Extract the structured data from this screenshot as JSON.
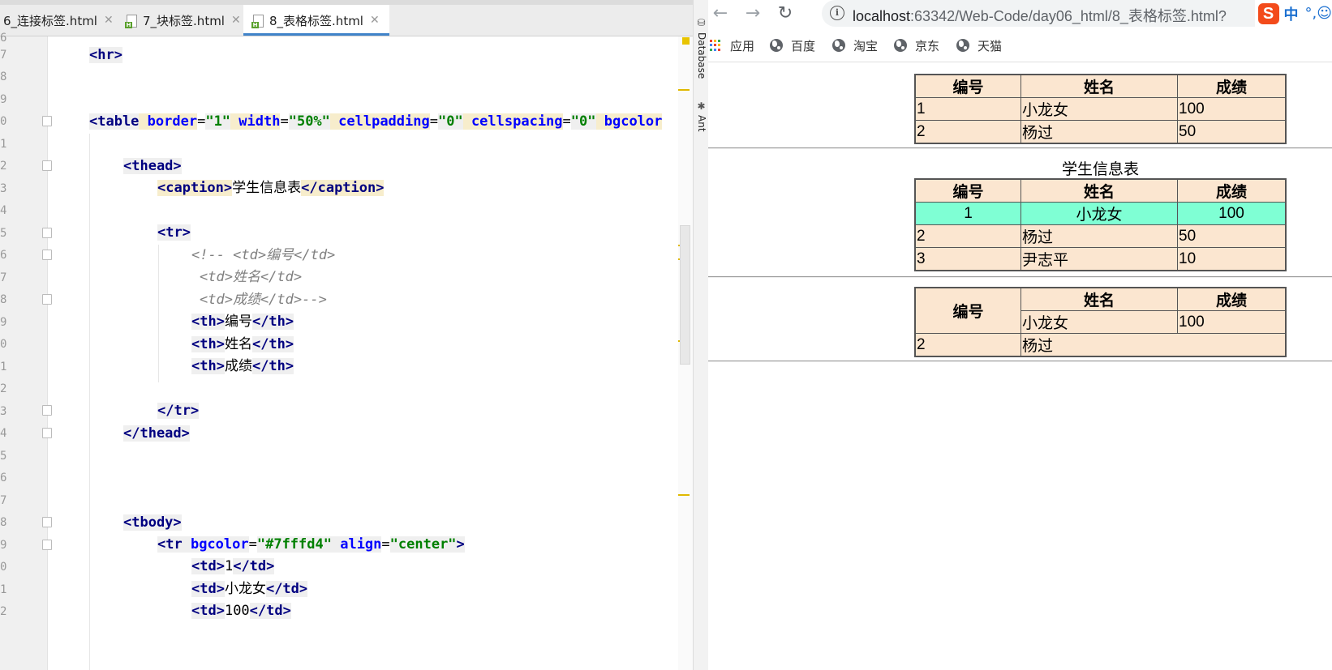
{
  "ide": {
    "tabs": [
      {
        "label": "6_连接标签.html",
        "active": false
      },
      {
        "label": "7_块标签.html",
        "active": false
      },
      {
        "label": "8_表格标签.html",
        "active": true
      }
    ],
    "line_numbers": [
      "6",
      "7",
      "8",
      "9",
      "0",
      "1",
      "2",
      "3",
      "4",
      "5",
      "6",
      "7",
      "8",
      "9",
      "0",
      "1",
      "2",
      "3",
      "4",
      "5",
      "6",
      "7",
      "8",
      "9",
      "0",
      "1",
      "2"
    ],
    "side_panels": [
      "Database",
      "Ant"
    ]
  },
  "browser": {
    "url_host": "localhost",
    "url_rest": ":63342/Web-Code/day06_html/8_表格标签.html?",
    "ime_label": "中",
    "ime_symbols": "°,☺",
    "bookmarks": [
      "应用",
      "百度",
      "淘宝",
      "京东",
      "天猫"
    ],
    "table1": {
      "headers": [
        "编号",
        "姓名",
        "成绩"
      ],
      "rows": [
        [
          "1",
          "小龙女",
          "100"
        ],
        [
          "2",
          "杨过",
          "50"
        ]
      ]
    },
    "table2": {
      "caption": "学生信息表",
      "headers": [
        "编号",
        "姓名",
        "成绩"
      ],
      "highlight_row": [
        "1",
        "小龙女",
        "100"
      ],
      "highlight_color": "#7fffd4",
      "rows": [
        [
          "2",
          "杨过",
          "50"
        ],
        [
          "3",
          "尹志平",
          "10"
        ]
      ]
    },
    "table3": {
      "headers": [
        "编号",
        "姓名",
        "成绩"
      ],
      "row1": [
        "小龙女",
        "100"
      ],
      "row2": [
        "2",
        "杨过"
      ]
    }
  },
  "code": {
    "l1": [
      "<hr>"
    ],
    "l4": [
      "<table",
      " border",
      "=",
      "\"1\"",
      " width",
      "=",
      "\"50%\"",
      " cellpadding",
      "=",
      "\"0\"",
      " cellspacing",
      "=",
      "\"0\"",
      " bgcolor"
    ],
    "l6": [
      "<thead>"
    ],
    "l7": [
      "<caption>",
      "学生信息表",
      "</caption>"
    ],
    "l9": [
      "<tr>"
    ],
    "l10": "<!-- <td>编号</td>",
    "l11": "<td>姓名</td>",
    "l12": "<td>成绩</td>-->",
    "l13": [
      "<th>",
      "编号",
      "</th>"
    ],
    "l14": [
      "<th>",
      "姓名",
      "</th>"
    ],
    "l15": [
      "<th>",
      "成绩",
      "</th>"
    ],
    "l17": [
      "</tr>"
    ],
    "l18": [
      "</thead>"
    ],
    "l22": [
      "<tbody>"
    ],
    "l23": [
      "<tr",
      " bgcolor",
      "=",
      "\"#7fffd4\"",
      " align",
      "=",
      "\"center\"",
      ">"
    ],
    "l24": [
      "<td>",
      "1",
      "</td>"
    ],
    "l25": [
      "<td>",
      "小龙女",
      "</td>"
    ],
    "l26": [
      "<td>",
      "100",
      "</td>"
    ]
  }
}
